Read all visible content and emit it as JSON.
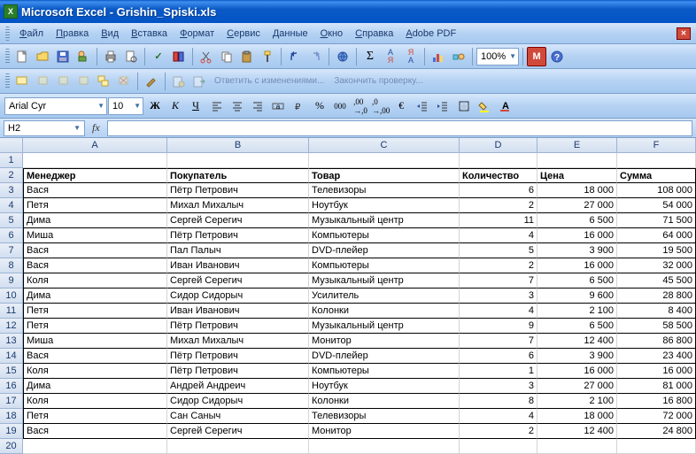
{
  "app": {
    "name": "Microsoft Excel",
    "file": "Grishin_Spiski.xls"
  },
  "menu": [
    "Файл",
    "Правка",
    "Вид",
    "Вставка",
    "Формат",
    "Сервис",
    "Данные",
    "Окно",
    "Справка",
    "Adobe PDF"
  ],
  "toolbar2": {
    "reply": "Ответить с изменениями...",
    "finish": "Закончить проверку..."
  },
  "format": {
    "font": "Arial Cyr",
    "size": "10",
    "bold": "Ж",
    "italic": "К",
    "underline": "Ч"
  },
  "zoom": "100%",
  "namebox": "H2",
  "fx": "fx",
  "columns": [
    {
      "letter": "A",
      "width": 163
    },
    {
      "letter": "B",
      "width": 160
    },
    {
      "letter": "C",
      "width": 170
    },
    {
      "letter": "D",
      "width": 88
    },
    {
      "letter": "E",
      "width": 90
    },
    {
      "letter": "F",
      "width": 89
    }
  ],
  "headers": [
    "Менеджер",
    "Покупатель",
    "Товар",
    "Количество",
    "Цена",
    "Сумма"
  ],
  "rows": [
    [
      "Вася",
      "Пётр Петрович",
      "Телевизоры",
      "6",
      "18 000",
      "108 000"
    ],
    [
      "Петя",
      "Михал Михалыч",
      "Ноутбук",
      "2",
      "27 000",
      "54 000"
    ],
    [
      "Дима",
      "Сергей Серегич",
      "Музыкальный центр",
      "11",
      "6 500",
      "71 500"
    ],
    [
      "Миша",
      "Пётр Петрович",
      "Компьютеры",
      "4",
      "16 000",
      "64 000"
    ],
    [
      "Вася",
      "Пал Палыч",
      "DVD-плейер",
      "5",
      "3 900",
      "19 500"
    ],
    [
      "Вася",
      "Иван Иванович",
      "Компьютеры",
      "2",
      "16 000",
      "32 000"
    ],
    [
      "Коля",
      "Сергей Серегич",
      "Музыкальный центр",
      "7",
      "6 500",
      "45 500"
    ],
    [
      "Дима",
      "Сидор Сидорыч",
      "Усилитель",
      "3",
      "9 600",
      "28 800"
    ],
    [
      "Петя",
      "Иван Иванович",
      "Колонки",
      "4",
      "2 100",
      "8 400"
    ],
    [
      "Петя",
      "Пётр Петрович",
      "Музыкальный центр",
      "9",
      "6 500",
      "58 500"
    ],
    [
      "Миша",
      "Михал Михалыч",
      "Монитор",
      "7",
      "12 400",
      "86 800"
    ],
    [
      "Вася",
      "Пётр Петрович",
      "DVD-плейер",
      "6",
      "3 900",
      "23 400"
    ],
    [
      "Коля",
      "Пётр Петрович",
      "Компьютеры",
      "1",
      "16 000",
      "16 000"
    ],
    [
      "Дима",
      "Андрей Андреич",
      "Ноутбук",
      "3",
      "27 000",
      "81 000"
    ],
    [
      "Коля",
      "Сидор Сидорыч",
      "Колонки",
      "8",
      "2 100",
      "16 800"
    ],
    [
      "Петя",
      "Сан Саныч",
      "Телевизоры",
      "4",
      "18 000",
      "72 000"
    ],
    [
      "Вася",
      "Сергей Серегич",
      "Монитор",
      "2",
      "12 400",
      "24 800"
    ]
  ]
}
